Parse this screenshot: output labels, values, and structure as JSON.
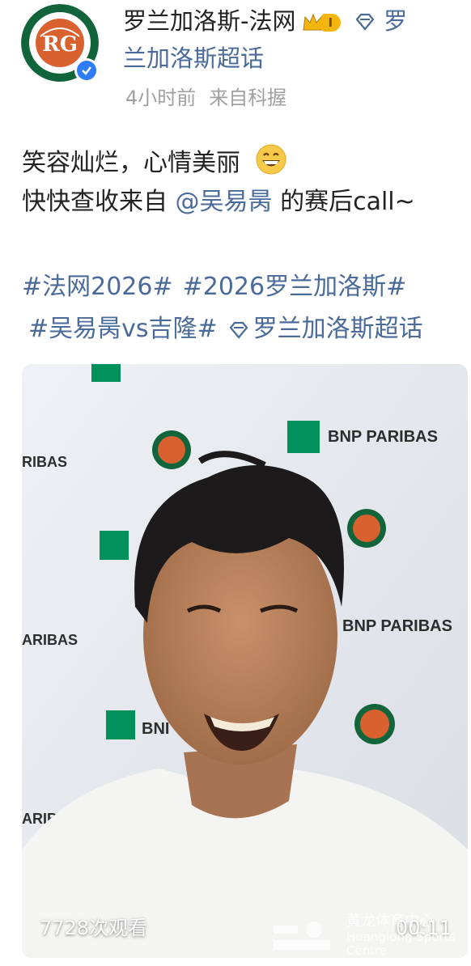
{
  "header": {
    "account_name": "罗兰加洛斯-法网",
    "level_badge": "I",
    "supertopic_name_line1": "罗",
    "supertopic_name_line2": "兰加洛斯超话",
    "time": "4小时前",
    "source": "来自科握",
    "avatar_icon": "roland-garros-logo",
    "verified_icon": "verified-check"
  },
  "post": {
    "line1": "笑容灿烂，心情美丽",
    "line2_prefix": "快快查收来自 ",
    "mention": "@吴易昺",
    "line2_suffix": " 的赛后call~",
    "hashtags_row1": [
      "#法网2026#",
      "#2026罗兰加洛斯#"
    ],
    "hashtags_row2": [
      "#吴易昺vs吉隆#",
      "罗兰加洛斯超话"
    ]
  },
  "video": {
    "views": "7728次观看",
    "duration": "00:11",
    "watermark_cn": "黄龙体育中心",
    "watermark_en": "Huanglong Sports Centre",
    "backdrop_texts": [
      "BNP PARIBAS",
      "RIBAS",
      "ARIBAS",
      "BNP PARIBAS",
      "BNI",
      "ARIBAS"
    ]
  },
  "colors": {
    "link": "#4a6a9a",
    "meta": "#a0a0a0",
    "verified": "#2e7cf6",
    "level_badge": "#f5b50f",
    "roland_garros_orange": "#d8612f",
    "bnp_green": "#00915a"
  }
}
